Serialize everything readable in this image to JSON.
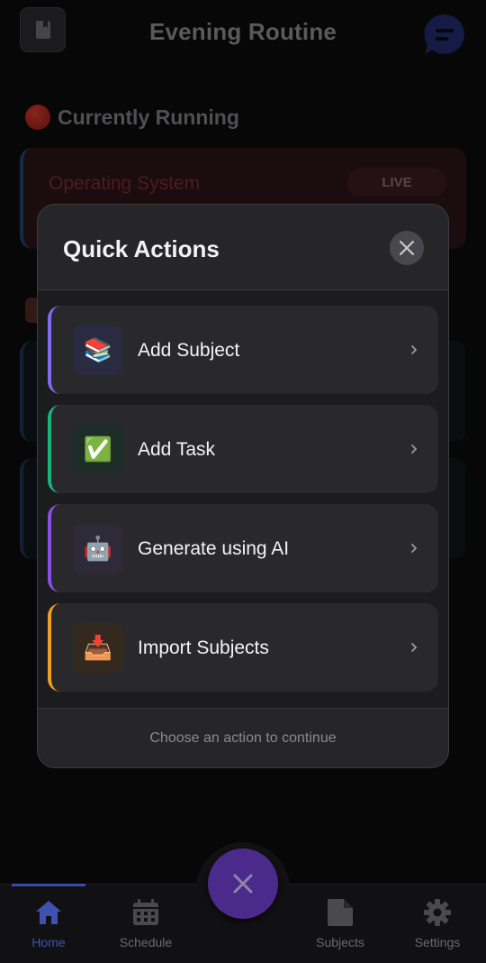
{
  "header": {
    "title": "Evening Routine",
    "book_icon": "book-icon",
    "chat_icon": "chat-bubble-icon"
  },
  "running": {
    "heading": "Currently Running",
    "heading_icon": "red-circle-icon",
    "card": {
      "name": "Operating System",
      "badge": "LIVE"
    }
  },
  "modal": {
    "title": "Quick Actions",
    "close_icon": "close-icon",
    "actions": [
      {
        "label": "Add Subject",
        "icon": "books-icon",
        "emoji": "📚",
        "accent": "#7b6cf0",
        "icon_bg": "#2a2a40"
      },
      {
        "label": "Add Task",
        "icon": "check-mark-icon",
        "emoji": "✅",
        "accent": "#19b37a",
        "icon_bg": "#1e2c27"
      },
      {
        "label": "Generate using AI",
        "icon": "robot-icon",
        "emoji": "🤖",
        "accent": "#8b4fe8",
        "icon_bg": "#2e2a3a"
      },
      {
        "label": "Import Subjects",
        "icon": "inbox-tray-icon",
        "emoji": "📥",
        "accent": "#f0a020",
        "icon_bg": "#33291f"
      }
    ],
    "footer": "Choose an action to continue"
  },
  "nav": {
    "items": [
      {
        "label": "Home",
        "icon": "home-icon",
        "active": true
      },
      {
        "label": "Schedule",
        "icon": "calendar-icon",
        "active": false
      },
      {
        "label": "Subjects",
        "icon": "document-icon",
        "active": false
      },
      {
        "label": "Settings",
        "icon": "gear-icon",
        "active": false
      }
    ],
    "fab_icon": "close-icon"
  },
  "colors": {
    "background": "#0b0b0c",
    "modal": "#262629",
    "fab": "#4a2a8a",
    "active_nav": "#3f52b0"
  }
}
